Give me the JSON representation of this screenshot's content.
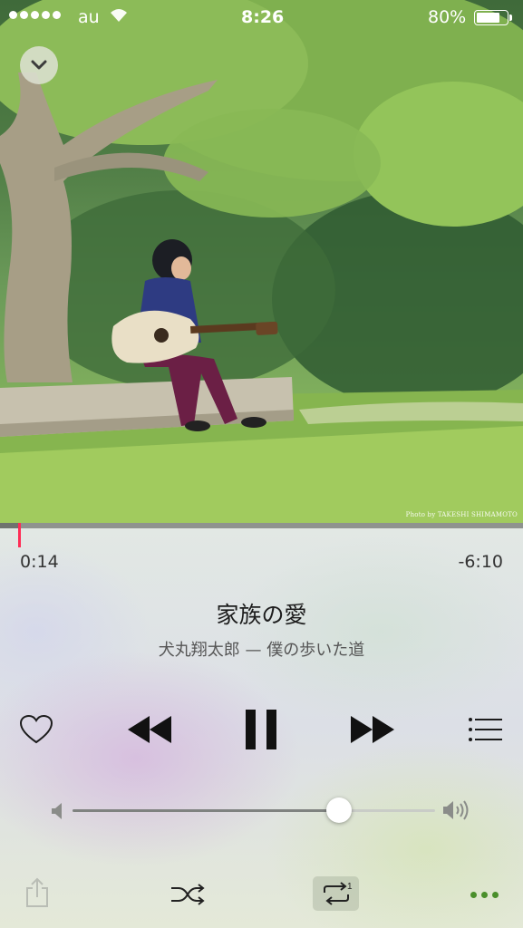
{
  "status_bar": {
    "carrier": "au",
    "time": "8:26",
    "battery_text": "80%",
    "battery_level": 0.8,
    "signal_bars": 5
  },
  "album_art": {
    "credit": "Photo by TAKESHI SHIMAMOTO"
  },
  "player": {
    "elapsed": "0:14",
    "remaining": "-6:10",
    "progress_fraction": 0.037,
    "title": "家族の愛",
    "subtitle": "犬丸翔太郎 — 僕の歩いた道",
    "volume_fraction": 0.735,
    "repeat_badge": "1"
  },
  "colors": {
    "progress_head": "#ff2d55",
    "more_dots": "#4a8f2b"
  },
  "icons": {
    "collapse": "chevron-down-icon",
    "love": "heart-icon",
    "previous": "rewind-icon",
    "pause": "pause-icon",
    "next": "fast-forward-icon",
    "up_next": "list-icon",
    "share": "share-icon",
    "shuffle": "shuffle-icon",
    "repeat": "repeat-one-icon",
    "more": "more-icon"
  }
}
